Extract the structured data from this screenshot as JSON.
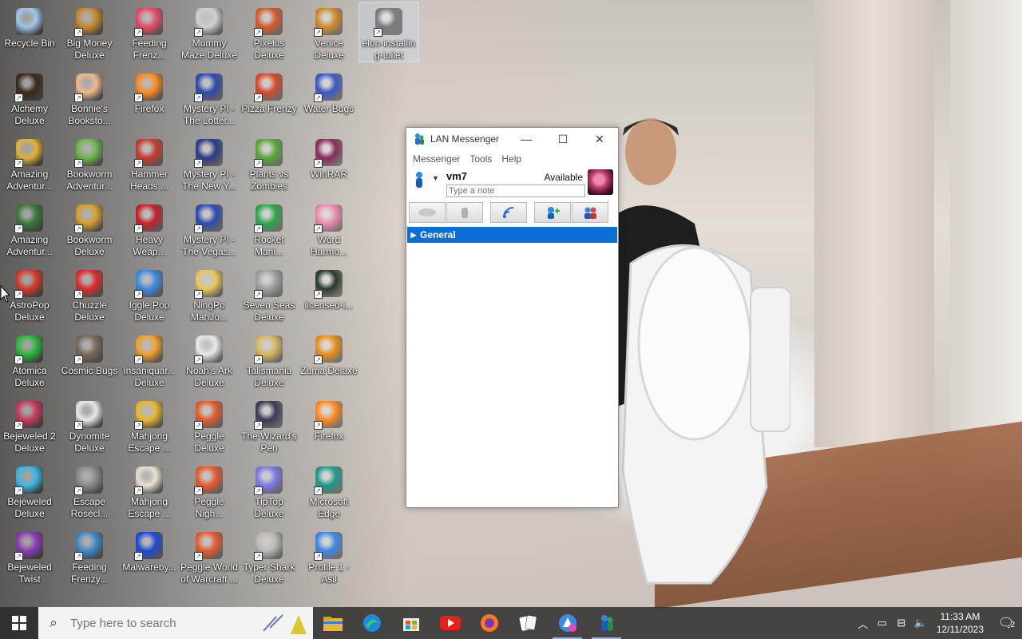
{
  "desktop": {
    "icons": [
      {
        "label": "Recycle Bin",
        "color": "#9ec6e8"
      },
      {
        "label": "Big Money Deluxe",
        "color": "#c58a2b"
      },
      {
        "label": "Feeding Frenz...",
        "color": "#e84a6a"
      },
      {
        "label": "Mummy Maze Deluxe",
        "color": "#cfcfcf"
      },
      {
        "label": "Pixelus Deluxe",
        "color": "#d75a2b"
      },
      {
        "label": "Venice Deluxe",
        "color": "#d28a2a"
      },
      {
        "label": "elon-installin g-toilet",
        "color": "#7d7d7d"
      },
      {
        "label": "Alchemy Deluxe",
        "color": "#3a2a1a"
      },
      {
        "label": "Bonnie's Booksto...",
        "color": "#f0b98a"
      },
      {
        "label": "Firefox",
        "color": "#ff8a1f"
      },
      {
        "label": "Mystery PI - The Lotter...",
        "color": "#2a4ab0"
      },
      {
        "label": "Pizza Frenzy",
        "color": "#d84a2a"
      },
      {
        "label": "Water Bugs",
        "color": "#3a58c8"
      },
      {
        "label": "Amazing Adventur...",
        "color": "#e3b23a"
      },
      {
        "label": "Bookworm Adventur...",
        "color": "#6ab84a"
      },
      {
        "label": "Hammer Heads ...",
        "color": "#c83a2a"
      },
      {
        "label": "Mystery PI - The New Y...",
        "color": "#2a3a8a"
      },
      {
        "label": "Plants vs Zombies",
        "color": "#5aa83a"
      },
      {
        "label": "WinRAR",
        "color": "#8a2a5a"
      },
      {
        "label": "Amazing Adventur...",
        "color": "#3a7a3a"
      },
      {
        "label": "Bookworm Deluxe",
        "color": "#d8a02a"
      },
      {
        "label": "Heavy Weap...",
        "color": "#c8202a"
      },
      {
        "label": "Mystery PI - The Vegas...",
        "color": "#2a4ab0"
      },
      {
        "label": "Rocket Mani...",
        "color": "#2aa84a"
      },
      {
        "label": "Word Harmo...",
        "color": "#f08ab0"
      },
      {
        "label": "AstroPop Deluxe",
        "color": "#d8382a"
      },
      {
        "label": "Chuzzle Deluxe",
        "color": "#e02a2a"
      },
      {
        "label": "Iggle Pop Deluxe",
        "color": "#3a8ae0"
      },
      {
        "label": "NingPo MahJo...",
        "color": "#e8c85a"
      },
      {
        "label": "Seven Seas Deluxe",
        "color": "#a0a0a0"
      },
      {
        "label": "licensed-i...",
        "color": "#2a3a2a"
      },
      {
        "label": "Atomica Deluxe",
        "color": "#2ab83a"
      },
      {
        "label": "Cosmic Bugs",
        "color": "#7a6a5a"
      },
      {
        "label": "Insaniquar... Deluxe",
        "color": "#f0a02a"
      },
      {
        "label": "Noah's Ark Deluxe",
        "color": "#e8e8e8"
      },
      {
        "label": "Talismania Deluxe",
        "color": "#d8b85a"
      },
      {
        "label": "Zuma Deluxe",
        "color": "#e8901a"
      },
      {
        "label": "Bejeweled 2 Deluxe",
        "color": "#c83a5a"
      },
      {
        "label": "Dynomite Deluxe",
        "color": "#e8e8e8"
      },
      {
        "label": "Mahjong Escape ...",
        "color": "#e8b82a"
      },
      {
        "label": "Peggle Deluxe",
        "color": "#e85a2a"
      },
      {
        "label": "The Wizard's Pen",
        "color": "#3a3a5a"
      },
      {
        "label": "Firefox",
        "color": "#ff8a1f"
      },
      {
        "label": "Bejeweled Deluxe",
        "color": "#3ab8e8"
      },
      {
        "label": "Escape Rosecl...",
        "color": "#8a8a8a"
      },
      {
        "label": "Mahjong Escape ...",
        "color": "#e8e0d0"
      },
      {
        "label": "Peggle Nigh...",
        "color": "#e85a2a"
      },
      {
        "label": "TipTop Deluxe",
        "color": "#7a7ae8"
      },
      {
        "label": "Microsoft Edge",
        "color": "#1e9a8a"
      },
      {
        "label": "Bejeweled Twist",
        "color": "#8a3ab8"
      },
      {
        "label": "Feeding Frenzy...",
        "color": "#3a8ac8"
      },
      {
        "label": "Malwareby...",
        "color": "#1a4ad8"
      },
      {
        "label": "Peggle World of Warcraft ...",
        "color": "#e85a2a"
      },
      {
        "label": "Typer Shark Deluxe",
        "color": "#b8b8b8"
      },
      {
        "label": "Profile 1 - Asil",
        "color": "#3a8ae8"
      }
    ]
  },
  "window": {
    "title": "LAN Messenger",
    "menu": [
      "Messenger",
      "Tools",
      "Help"
    ],
    "user_name": "vm7",
    "status": "Available",
    "note_placeholder": "Type a note",
    "group_label": "General",
    "minimize_glyph": "—",
    "maximize_glyph": "☐",
    "close_glyph": "✕"
  },
  "taskbar": {
    "search_placeholder": "Type here to search",
    "time": "11:33 AM",
    "date": "12/11/2023",
    "notification_count": "2"
  }
}
